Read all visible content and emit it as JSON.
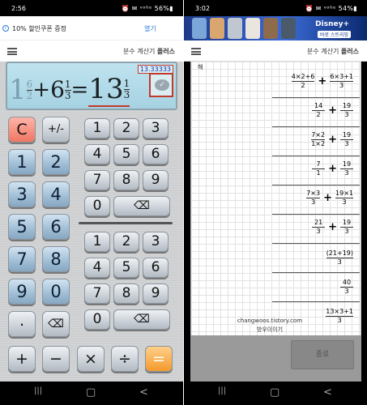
{
  "left_phone": {
    "status_time": "2:56",
    "status_right": "⏰ ✉ ᵛᵒˡᵗᵉ 56%▮",
    "ad": {
      "info_icon": "i",
      "text": "10% 할인쿠폰 증정",
      "open_label": "열기"
    },
    "app_title_prefix": "분수 계산기 ",
    "app_title_bold": "플러스",
    "display": {
      "memory_value": "13.33333",
      "whole_a": "1",
      "num_a": "6",
      "den_a": "2",
      "plus": "+",
      "whole_b": "6",
      "num_b": "1",
      "den_b": "3",
      "equals": "=",
      "whole_r": "13",
      "num_r": "1",
      "den_r": "3",
      "action_icon": "check-icon"
    },
    "keys": {
      "clear": "C",
      "sign": "+/-",
      "one": "1",
      "two": "2",
      "three": "3",
      "four": "4",
      "five": "5",
      "six": "6",
      "seven": "7",
      "eight": "8",
      "nine": "9",
      "zero": "0",
      "dot": ".",
      "backspace": "⌫",
      "plus": "+",
      "minus": "−",
      "times": "×",
      "divide": "÷",
      "equals": "="
    },
    "nav": {
      "recents": "|||",
      "home": "▢",
      "back": "<"
    }
  },
  "right_phone": {
    "status_time": "3:02",
    "status_right": "⏰ ✉ ᵛᵒˡᵗᵉ 54%▮",
    "ad": {
      "brand": "Disney+",
      "cta": "바로 스트리밍"
    },
    "app_title_prefix": "분수 계산기 ",
    "app_title_bold": "플러스",
    "grid_label": "해",
    "steps": {
      "s1": {
        "n1": "4×2+6",
        "d1": "2",
        "op": "+",
        "n2": "6×3+1",
        "d2": "3"
      },
      "s2": {
        "n1": "14",
        "d1": "2",
        "op": "+",
        "n2": "19",
        "d2": "3"
      },
      "s3": {
        "n1": "7×2",
        "d1": "1×2",
        "op": "+",
        "n2": "19",
        "d2": "3"
      },
      "s4": {
        "n1": "7",
        "d1": "1",
        "op": "+",
        "n2": "19",
        "d2": "3"
      },
      "s5": {
        "n1": "7×3",
        "d1": "3",
        "op": "+",
        "n2": "19×1",
        "d2": "3"
      },
      "s6": {
        "n1": "21",
        "d1": "3",
        "op": "+",
        "n2": "19",
        "d2": "3"
      },
      "s7": {
        "paren": "(21+19)",
        "d": "3"
      },
      "s8": {
        "n": "40",
        "d": "3"
      },
      "s9": {
        "n": "13×3+1",
        "d": "3"
      }
    },
    "watermark_line1": "changwoos.tistory.com",
    "watermark_line2": "방우이이기",
    "end_button": "종료",
    "nav": {
      "recents": "|||",
      "home": "▢",
      "back": "<"
    }
  }
}
